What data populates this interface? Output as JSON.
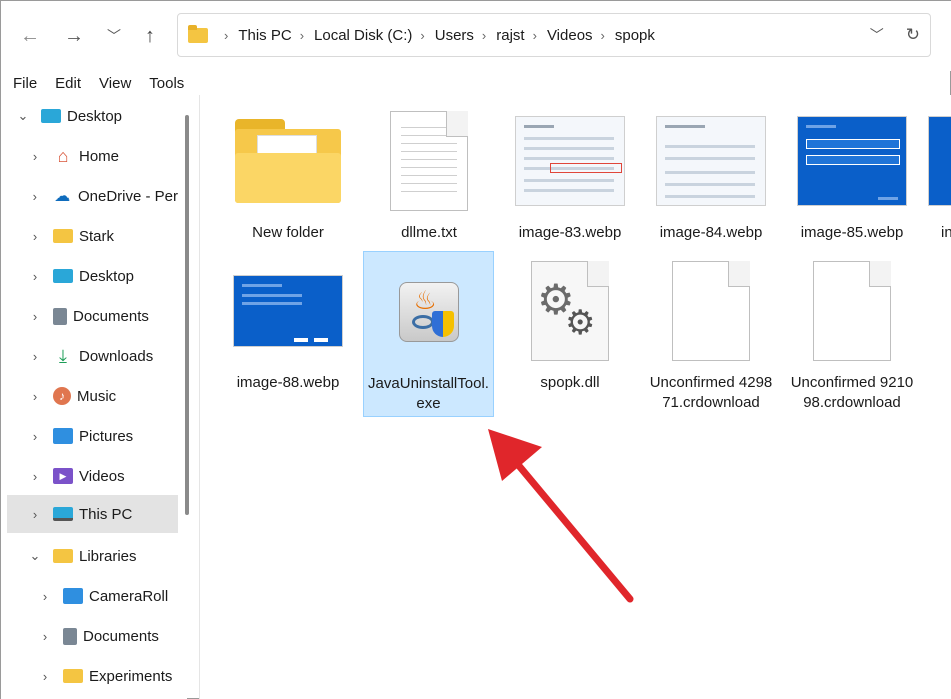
{
  "nav": {
    "back_icon": "arrow-left-icon",
    "forward_icon": "arrow-right-icon",
    "recent_icon": "chevron-down-icon",
    "up_icon": "arrow-up-icon"
  },
  "address": {
    "crumbs": [
      "This PC",
      "Local Disk (C:)",
      "Users",
      "rajst",
      "Videos",
      "spopk"
    ],
    "dropdown_icon": "chevron-down-icon",
    "refresh_icon": "refresh-icon"
  },
  "menu": [
    "File",
    "Edit",
    "View",
    "Tools"
  ],
  "sidebar": {
    "items": [
      {
        "label": "Desktop",
        "icon": "desktop-icon",
        "expanded": true
      },
      {
        "label": "Home",
        "icon": "home-icon"
      },
      {
        "label": "OneDrive - Per",
        "icon": "cloud-icon"
      },
      {
        "label": "Stark",
        "icon": "folder-icon"
      },
      {
        "label": "Desktop",
        "icon": "desktop-icon"
      },
      {
        "label": "Documents",
        "icon": "documents-icon"
      },
      {
        "label": "Downloads",
        "icon": "download-icon"
      },
      {
        "label": "Music",
        "icon": "music-icon"
      },
      {
        "label": "Pictures",
        "icon": "pictures-icon"
      },
      {
        "label": "Videos",
        "icon": "videos-icon"
      },
      {
        "label": "This PC",
        "icon": "computer-icon",
        "selected": true
      },
      {
        "label": "Libraries",
        "icon": "folder-icon",
        "expanded": true
      },
      {
        "label": "CameraRoll",
        "icon": "pictures-icon"
      },
      {
        "label": "Documents",
        "icon": "documents-icon"
      },
      {
        "label": "Experiments",
        "icon": "folder-icon"
      }
    ]
  },
  "files": [
    {
      "name": "New folder",
      "type": "folder"
    },
    {
      "name": "dllme.txt",
      "type": "text"
    },
    {
      "name": "image-83.webp",
      "type": "image"
    },
    {
      "name": "image-84.webp",
      "type": "image"
    },
    {
      "name": "image-85.webp",
      "type": "image"
    },
    {
      "name": "in",
      "type": "image"
    },
    {
      "name": "image-88.webp",
      "type": "image"
    },
    {
      "name": "JavaUninstallTool.exe",
      "type": "exe",
      "selected": true
    },
    {
      "name": "spopk.dll",
      "type": "dll"
    },
    {
      "name": "Unconfirmed 429871.crdownload",
      "type": "blank"
    },
    {
      "name": "Unconfirmed 921098.crdownload",
      "type": "blank"
    }
  ],
  "colors": {
    "selection_bg": "#cce8ff",
    "sidebar_selected": "#e3e3e3",
    "annotation_arrow": "#e0262b"
  }
}
